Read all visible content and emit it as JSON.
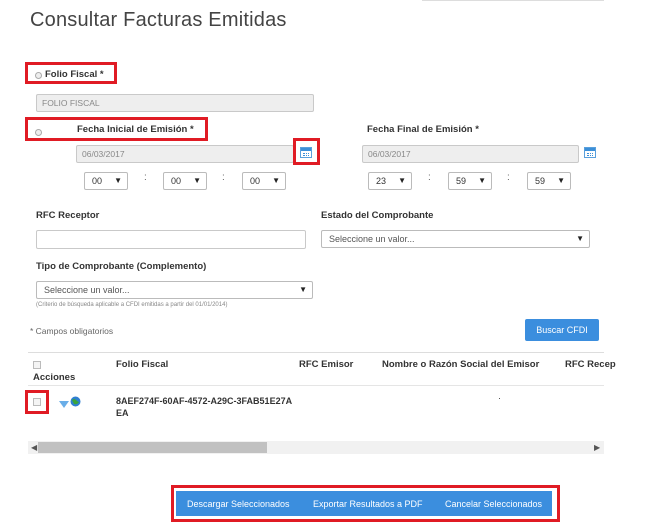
{
  "page": {
    "title": "Consultar Facturas Emitidas"
  },
  "folio": {
    "label": "Folio Fiscal *",
    "placeholder": "FOLIO FISCAL"
  },
  "fecha_inicial": {
    "label": "Fecha Inicial de Emisión *",
    "value": "06/03/2017",
    "hour": "00",
    "minute": "00",
    "second": "00"
  },
  "fecha_final": {
    "label": "Fecha Final de Emisión *",
    "value": "06/03/2017",
    "hour": "23",
    "minute": "59",
    "second": "59"
  },
  "rfc_receptor": {
    "label": "RFC Receptor",
    "value": ""
  },
  "estado": {
    "label": "Estado del Comprobante",
    "selected": "Seleccione un valor..."
  },
  "tipo": {
    "label": "Tipo de Comprobante (Complemento)",
    "selected": "Seleccione un valor...",
    "note": "(Criterio de búsqueda aplicable a CFDI emitidas a partir del 01/01/2014)"
  },
  "required_note": "* Campos obligatorios",
  "search_button": "Buscar CFDI",
  "table": {
    "headers": {
      "acciones": "Acciones",
      "folio": "Folio Fiscal",
      "rfc_emisor": "RFC Emisor",
      "nombre": "Nombre o Razón Social del Emisor",
      "rfc_receptor": "RFC Recep"
    },
    "rows": [
      {
        "folio_line1": "8AEF274F-60AF-4572-A29C-3FAB51E27A",
        "folio_line2": "EA",
        "rfc_emisor": "",
        "nombre": "",
        "rfc_receptor": ""
      }
    ]
  },
  "actions": {
    "download": "Descargar Seleccionados",
    "export": "Exportar Resultados a PDF",
    "cancel": "Cancelar Seleccionados"
  },
  "colors": {
    "accent": "#3b8ede",
    "highlight": "#e01b24"
  },
  "icons": [
    "radio-icon",
    "calendar-icon",
    "chevron-down-icon",
    "checkbox-icon",
    "download-icon",
    "globe-icon",
    "arrow-left-icon",
    "arrow-right-icon"
  ]
}
